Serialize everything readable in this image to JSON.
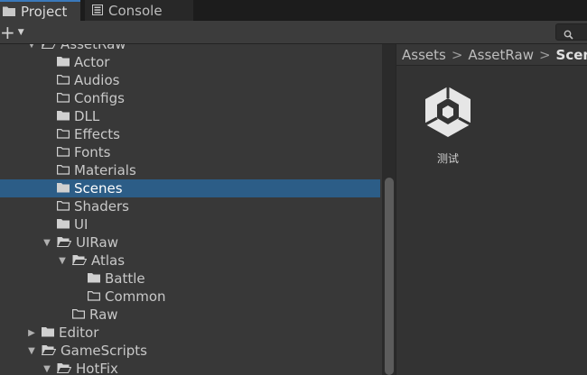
{
  "tabs": [
    {
      "label": "Project",
      "icon": "folder-icon"
    },
    {
      "label": "Console",
      "icon": "console-icon"
    }
  ],
  "toolbar": {
    "add_icon": "plus-icon",
    "search_icon": "search-icon"
  },
  "tree": [
    {
      "label": "AssetRaw",
      "depth": 1,
      "expanded": true,
      "open_folder": true
    },
    {
      "label": "Actor",
      "depth": 2,
      "filled": true
    },
    {
      "label": "Audios",
      "depth": 2,
      "filled": false
    },
    {
      "label": "Configs",
      "depth": 2,
      "filled": false
    },
    {
      "label": "DLL",
      "depth": 2,
      "filled": true
    },
    {
      "label": "Effects",
      "depth": 2,
      "filled": false
    },
    {
      "label": "Fonts",
      "depth": 2,
      "filled": false
    },
    {
      "label": "Materials",
      "depth": 2,
      "filled": false
    },
    {
      "label": "Scenes",
      "depth": 2,
      "filled": true,
      "selected": true
    },
    {
      "label": "Shaders",
      "depth": 2,
      "filled": false
    },
    {
      "label": "UI",
      "depth": 2,
      "filled": true
    },
    {
      "label": "UIRaw",
      "depth": 2,
      "expanded": true,
      "open_folder": true
    },
    {
      "label": "Atlas",
      "depth": 3,
      "expanded": true,
      "open_folder": true
    },
    {
      "label": "Battle",
      "depth": 4,
      "filled": true
    },
    {
      "label": "Common",
      "depth": 4,
      "filled": false
    },
    {
      "label": "Raw",
      "depth": 3,
      "filled": false
    },
    {
      "label": "Editor",
      "depth": 1,
      "collapsed": true,
      "filled": true
    },
    {
      "label": "GameScripts",
      "depth": 1,
      "expanded": true,
      "open_folder": true
    },
    {
      "label": "HotFix",
      "depth": 2,
      "expanded": true,
      "open_folder": true
    }
  ],
  "breadcrumb": [
    "Assets",
    "AssetRaw",
    "Scenes"
  ],
  "assets": [
    {
      "label": "测试",
      "icon": "unity-scene-icon"
    }
  ],
  "colors": {
    "selection": "#2c5d87",
    "tab_accent": "#3a79bb",
    "panel": "#383838"
  }
}
